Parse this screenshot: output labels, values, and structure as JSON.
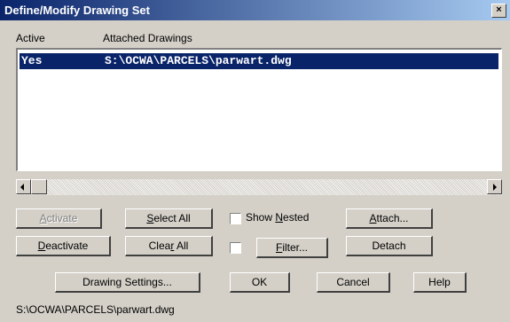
{
  "window": {
    "title": "Define/Modify Drawing Set",
    "close_label": "×"
  },
  "columns": {
    "active": "Active",
    "attached": "Attached Drawings"
  },
  "rows": [
    {
      "active": "Yes",
      "path": "S:\\OCWA\\PARCELS\\parwart.dwg"
    }
  ],
  "buttons": {
    "activate": {
      "underline": "A",
      "rest": "ctivate"
    },
    "select_all": {
      "underline": "S",
      "rest": "elect All"
    },
    "attach": {
      "underline": "A",
      "rest": "ttach..."
    },
    "deactivate": {
      "underline": "D",
      "rest": "eactivate"
    },
    "clear_all_pre": "Clea",
    "clear_all_u": "r",
    "clear_all_post": " All",
    "filter": {
      "underline": "F",
      "rest": "ilter..."
    },
    "detach": "Detach",
    "drawing_settings": "Drawing Settings...",
    "ok": "OK",
    "cancel": "Cancel",
    "help": "Help"
  },
  "checkboxes": {
    "show_nested": {
      "pre": "Show ",
      "underline": "N",
      "post": "ested"
    }
  },
  "status_path": "S:\\OCWA\\PARCELS\\parwart.dwg"
}
